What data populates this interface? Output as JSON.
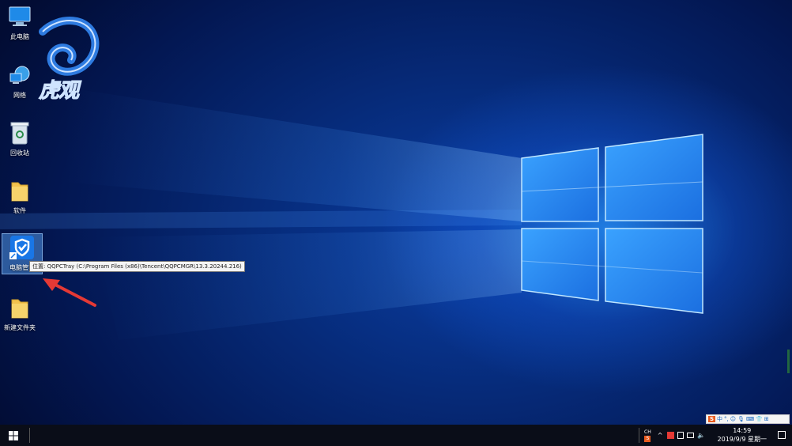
{
  "desktop": {
    "icons": [
      {
        "label": "此电脑",
        "icon": "computer-icon"
      },
      {
        "label": "网络",
        "icon": "network-icon"
      },
      {
        "label": "回收站",
        "icon": "recycle-bin-icon"
      },
      {
        "label": "软件",
        "icon": "folder-icon"
      },
      {
        "label": "电脑管家",
        "icon": "tencent-pc-manager-icon",
        "selected": true
      },
      {
        "label": "新建文件夹",
        "icon": "folder-icon"
      }
    ],
    "tooltip": "位置: QQPCTray (C:\\Program Files (x86)\\Tencent\\QQPCMGR\\13.3.20244.216)",
    "watermark_text": "虎观"
  },
  "ime_bar": {
    "items": [
      "S",
      "中",
      "°,",
      "☺",
      "🎙",
      "⌨",
      "👕",
      "⊞"
    ]
  },
  "taskbar": {
    "lang": "CH",
    "time": "14:59",
    "date": "2019/9/9 星期一",
    "colors": {
      "background": "#0a0d18",
      "accent": "#0078d7"
    }
  }
}
